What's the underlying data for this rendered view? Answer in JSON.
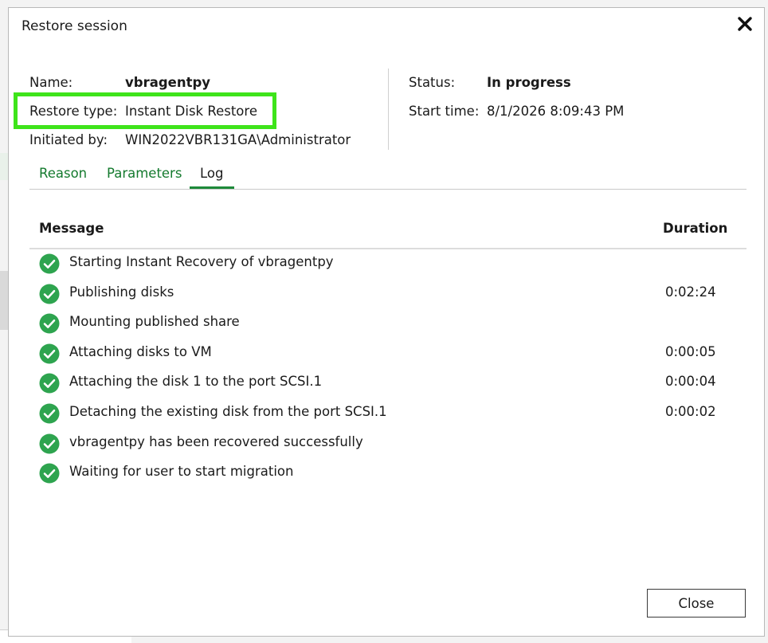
{
  "dialog": {
    "title": "Restore session",
    "close_icon": "close-icon"
  },
  "summary": {
    "name_label": "Name:",
    "name_value": "vbragentpy",
    "restore_type_label": "Restore type:",
    "restore_type_value": "Instant Disk Restore",
    "initiated_by_label": "Initiated by:",
    "initiated_by_value": "WIN2022VBR131GA\\Administrator",
    "status_label": "Status:",
    "status_value": "In progress",
    "start_time_label": "Start time:",
    "start_time_value": "8/1/2026 8:09:43 PM"
  },
  "tabs": [
    {
      "label": "Reason"
    },
    {
      "label": "Parameters"
    },
    {
      "label": "Log",
      "active": true
    }
  ],
  "log": {
    "columns": {
      "message": "Message",
      "duration": "Duration"
    },
    "rows": [
      {
        "message": "Starting Instant Recovery of vbragentpy",
        "duration": ""
      },
      {
        "message": "Publishing disks",
        "duration": "0:02:24"
      },
      {
        "message": "Mounting published share",
        "duration": ""
      },
      {
        "message": "Attaching disks to VM",
        "duration": "0:00:05"
      },
      {
        "message": "Attaching the disk 1 to the port SCSI.1",
        "duration": "0:00:04"
      },
      {
        "message": "Detaching the existing disk from the port SCSI.1",
        "duration": "0:00:02"
      },
      {
        "message": "vbragentpy has been recovered successfully",
        "duration": ""
      },
      {
        "message": "Waiting for user to start migration",
        "duration": ""
      }
    ],
    "row_icon": "success-check-icon"
  },
  "footer": {
    "close_label": "Close"
  },
  "colors": {
    "accent_green": "#1e8a3a",
    "success_green": "#2ea44f",
    "highlight_green": "#3ee41a",
    "tab_link_green": "#147a2e"
  }
}
